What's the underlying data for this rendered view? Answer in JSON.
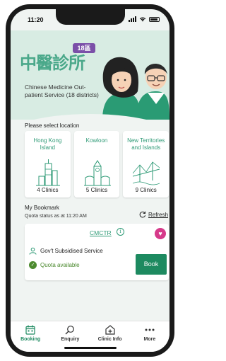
{
  "status_bar": {
    "time": "11:20"
  },
  "header": {
    "logo_text": "中醫診所",
    "badge": "18區",
    "service_title": "Chinese Medicine Out-patient Service (18 districts)"
  },
  "location": {
    "prompt": "Please select location",
    "regions": [
      {
        "name": "Hong Kong Island",
        "count": "4 Clinics"
      },
      {
        "name": "Kowloon",
        "count": "5 Clinics"
      },
      {
        "name": "New Territories and Islands",
        "count": "9 Clinics"
      }
    ]
  },
  "bookmark": {
    "title": "My Bookmark",
    "quota_status": "Quota status as at 11:20 AM",
    "refresh_label": "Refresh",
    "card": {
      "clinic": "CMCTR",
      "service": "Gov't Subsidised Service",
      "quota": "Quota available",
      "book_label": "Book"
    }
  },
  "tabs": [
    {
      "label": "Booking",
      "icon": "calendar-icon",
      "active": true
    },
    {
      "label": "Enquiry",
      "icon": "search-icon",
      "active": false
    },
    {
      "label": "Clinic Info",
      "icon": "clinic-icon",
      "active": false
    },
    {
      "label": "More",
      "icon": "more-icon",
      "active": false
    }
  ],
  "colors": {
    "accent": "#1d8a60",
    "favorite": "#d63a8a",
    "available": "#4c8a2f"
  }
}
